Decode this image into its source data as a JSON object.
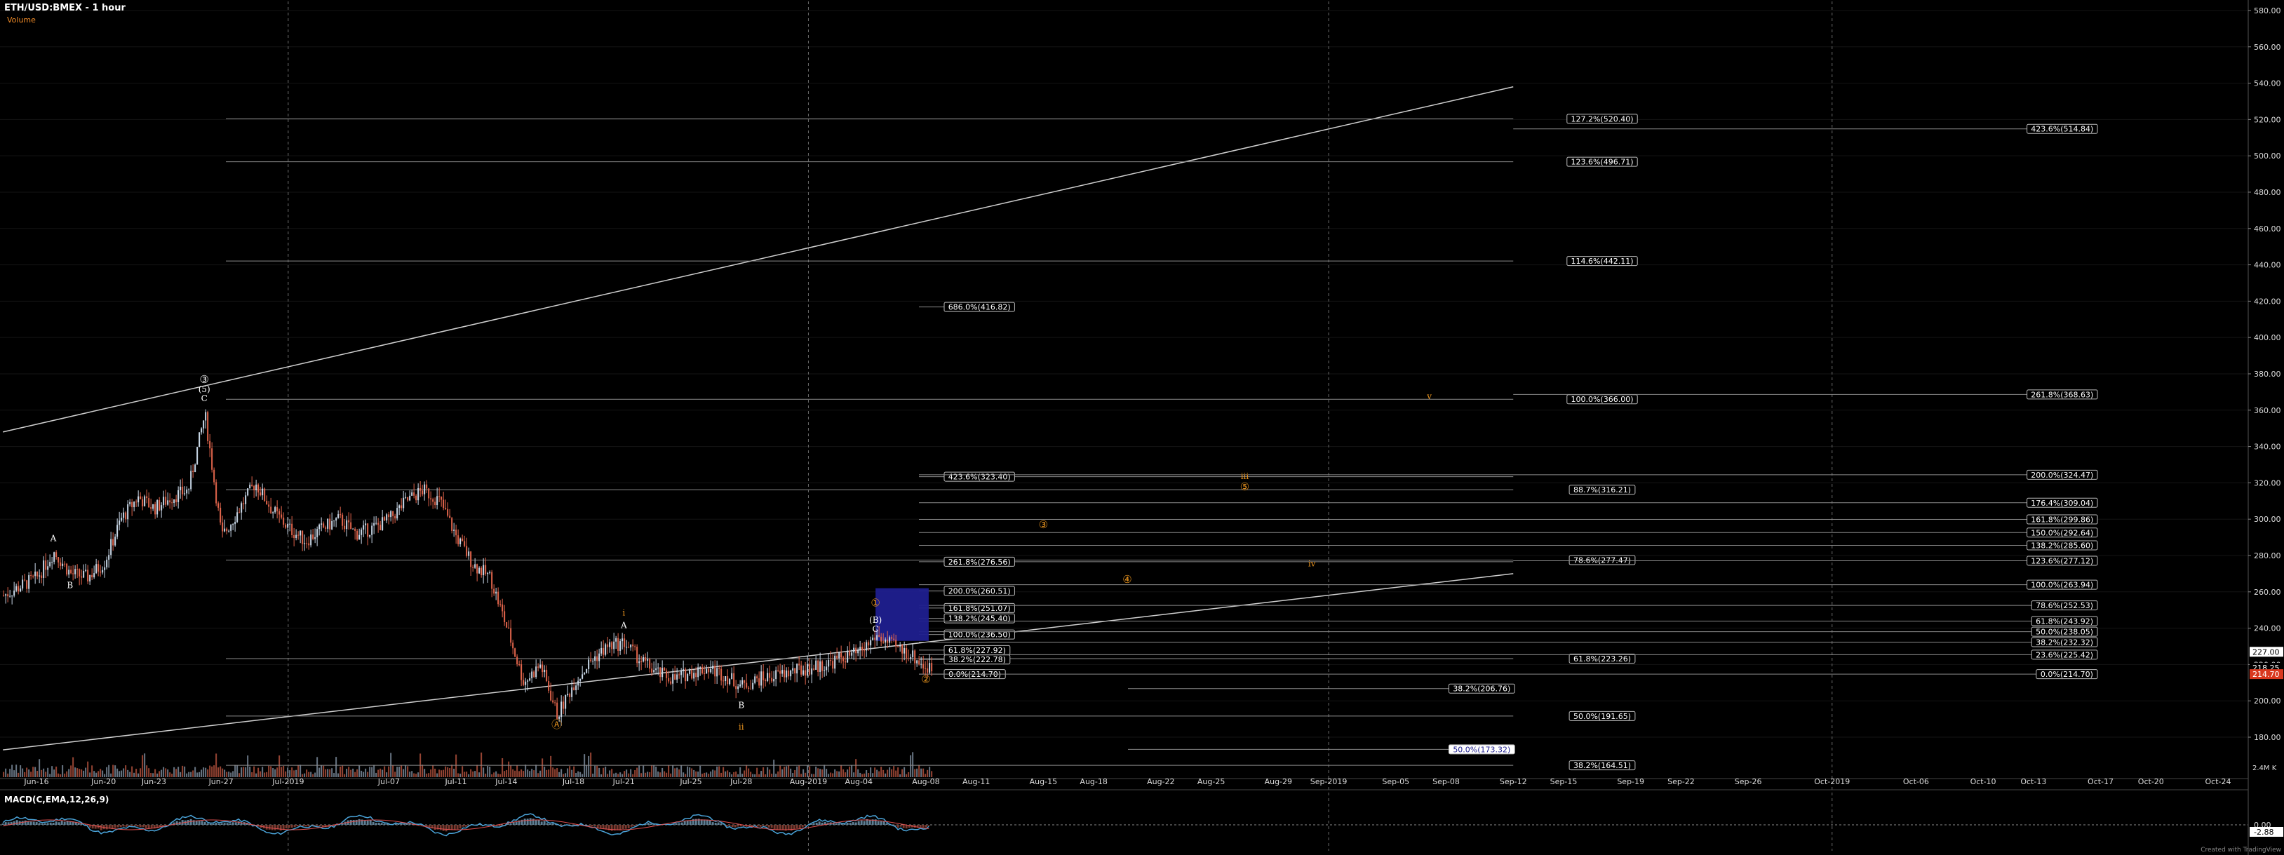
{
  "header": {
    "title": "ETH/USD:BMEX - 1 hour",
    "subtitle": "Volume"
  },
  "macd": {
    "label": "MACD(C,EMA,12,26,9)",
    "value_1": "0.00",
    "value_2": "-2.88"
  },
  "footer": {
    "volume_readout": "2.4M K",
    "watermark": "Created with TradingView"
  },
  "colors": {
    "background": "#000000",
    "grid": "#3a3a3a",
    "fib_line": "#8a8a8a",
    "candle_up": "#c9d8e8",
    "candle_down": "#e2654c",
    "wave_orange": "#e8931e",
    "wave_white": "#ffffff",
    "box_fill": "#1f1f8f",
    "macd": "#4aa3d8",
    "signal": "#e05050"
  },
  "chart_data": {
    "type": "candlestick",
    "title": "ETH/USD:BMEX - 1 hour",
    "ylim": [
      158,
      585
    ],
    "price_axis_ticks": [
      180,
      200,
      220,
      240,
      260,
      280,
      300,
      320,
      340,
      360,
      380,
      400,
      420,
      440,
      460,
      480,
      500,
      520,
      540,
      560,
      580
    ],
    "price_axis_tick_labels": [
      "180.00",
      "200.00",
      "220.00",
      "240.00",
      "260.00",
      "280.00",
      "300.00",
      "320.00",
      "340.00",
      "360.00",
      "380.00",
      "400.00",
      "420.00",
      "440.00",
      "460.00",
      "480.00",
      "500.00",
      "520.00",
      "540.00",
      "560.00",
      "580.00"
    ],
    "price_axis_markers": [
      {
        "value": 227.0,
        "label": "227.00",
        "style": "white"
      },
      {
        "value": 218.25,
        "label": "218.25",
        "style": "plain"
      },
      {
        "value": 214.7,
        "label": "214.70",
        "style": "red"
      }
    ],
    "date_ticks": [
      "Jun-16",
      "Jun-20",
      "Jun-23",
      "Jun-27",
      "Jul-2019",
      "Jul-07",
      "Jul-11",
      "Jul-14",
      "Jul-18",
      "Jul-21",
      "Jul-25",
      "Jul-28",
      "Aug-2019",
      "Aug-04",
      "Aug-08",
      "Aug-11",
      "Aug-15",
      "Aug-18",
      "Aug-22",
      "Aug-25",
      "Aug-29",
      "Sep-2019",
      "Sep-05",
      "Sep-08",
      "Sep-12",
      "Sep-15",
      "Sep-19",
      "Sep-22",
      "Sep-26",
      "Oct-2019",
      "Oct-06",
      "Oct-10",
      "Oct-13",
      "Oct-17",
      "Oct-20",
      "Oct-24"
    ],
    "month_separators": [
      "Jul-2019",
      "Aug-2019",
      "Sep-2019",
      "Oct-2019"
    ],
    "price_path": [
      {
        "date": "Jun-14",
        "price": 258
      },
      {
        "date": "Jun-16",
        "price": 268
      },
      {
        "date": "Jun-17",
        "price": 282
      },
      {
        "date": "Jun-18",
        "price": 270
      },
      {
        "date": "Jun-19",
        "price": 268
      },
      {
        "date": "Jun-20",
        "price": 276
      },
      {
        "date": "Jun-21",
        "price": 300
      },
      {
        "date": "Jun-22",
        "price": 312
      },
      {
        "date": "Jun-23",
        "price": 306
      },
      {
        "date": "Jun-24",
        "price": 312
      },
      {
        "date": "Jun-25",
        "price": 316
      },
      {
        "date": "Jun-26",
        "price": 358
      },
      {
        "date": "Jun-27",
        "price": 290
      },
      {
        "date": "Jun-28",
        "price": 305
      },
      {
        "date": "Jun-29",
        "price": 320
      },
      {
        "date": "Jun-30",
        "price": 305
      },
      {
        "date": "Jul-01",
        "price": 295
      },
      {
        "date": "Jul-02",
        "price": 288
      },
      {
        "date": "Jul-03",
        "price": 295
      },
      {
        "date": "Jul-04",
        "price": 300
      },
      {
        "date": "Jul-05",
        "price": 292
      },
      {
        "date": "Jul-06",
        "price": 295
      },
      {
        "date": "Jul-07",
        "price": 300
      },
      {
        "date": "Jul-08",
        "price": 310
      },
      {
        "date": "Jul-09",
        "price": 316
      },
      {
        "date": "Jul-10",
        "price": 310
      },
      {
        "date": "Jul-11",
        "price": 290
      },
      {
        "date": "Jul-12",
        "price": 275
      },
      {
        "date": "Jul-13",
        "price": 268
      },
      {
        "date": "Jul-14",
        "price": 240
      },
      {
        "date": "Jul-15",
        "price": 210
      },
      {
        "date": "Jul-16",
        "price": 220
      },
      {
        "date": "Jul-17",
        "price": 192
      },
      {
        "date": "Jul-18",
        "price": 210
      },
      {
        "date": "Jul-19",
        "price": 222
      },
      {
        "date": "Jul-20",
        "price": 230
      },
      {
        "date": "Jul-21",
        "price": 232
      },
      {
        "date": "Jul-22",
        "price": 222
      },
      {
        "date": "Jul-23",
        "price": 215
      },
      {
        "date": "Jul-24",
        "price": 212
      },
      {
        "date": "Jul-25",
        "price": 216
      },
      {
        "date": "Jul-26",
        "price": 218
      },
      {
        "date": "Jul-27",
        "price": 214
      },
      {
        "date": "Jul-28",
        "price": 208
      },
      {
        "date": "Jul-29",
        "price": 212
      },
      {
        "date": "Jul-30",
        "price": 214
      },
      {
        "date": "Jul-31",
        "price": 216
      },
      {
        "date": "Aug-01",
        "price": 218
      },
      {
        "date": "Aug-02",
        "price": 220
      },
      {
        "date": "Aug-03",
        "price": 224
      },
      {
        "date": "Aug-04",
        "price": 226
      },
      {
        "date": "Aug-05",
        "price": 236
      },
      {
        "date": "Aug-06",
        "price": 230
      },
      {
        "date": "Aug-07",
        "price": 226
      },
      {
        "date": "Aug-08",
        "price": 218
      }
    ],
    "fib_levels": [
      {
        "label": "127.2%(520.40)",
        "value": 520.4,
        "from": "Jun-26",
        "to": "Sep-12",
        "box": "center"
      },
      {
        "label": "123.6%(496.71)",
        "value": 496.71,
        "from": "Jun-26",
        "to": "Sep-12",
        "box": "center"
      },
      {
        "label": "114.6%(442.11)",
        "value": 442.11,
        "from": "Jun-26",
        "to": "Sep-12",
        "box": "center"
      },
      {
        "label": "100.0%(366.00)",
        "value": 366.0,
        "from": "Jun-26",
        "to": "Sep-12",
        "box": "center"
      },
      {
        "label": "88.7%(316.21)",
        "value": 316.21,
        "from": "Jun-26",
        "to": "Sep-12",
        "box": "center"
      },
      {
        "label": "78.6%(277.47)",
        "value": 277.47,
        "from": "Jun-26",
        "to": "Sep-12",
        "box": "center"
      },
      {
        "label": "61.8%(223.26)",
        "value": 223.26,
        "from": "Jun-26",
        "to": "Sep-12",
        "box": "center"
      },
      {
        "label": "50.0%(191.65)",
        "value": 191.65,
        "from": "Jun-26",
        "to": "Sep-12",
        "box": "center"
      },
      {
        "label": "38.2%(164.51)",
        "value": 164.51,
        "from": "Jun-26",
        "to": "Sep-12",
        "box": "center"
      },
      {
        "label": "686.0%(416.82)",
        "value": 416.82,
        "from": "Aug-08",
        "to": "Aug-08",
        "box": "left"
      },
      {
        "label": "423.6%(323.40)",
        "value": 323.4,
        "from": "Aug-08",
        "to": "Sep-12",
        "box": "left"
      },
      {
        "label": "261.8%(276.56)",
        "value": 276.56,
        "from": "Aug-08",
        "to": "Sep-12",
        "box": "left"
      },
      {
        "label": "200.0%(260.51)",
        "value": 260.51,
        "from": "Aug-08",
        "to": "Aug-08",
        "box": "left"
      },
      {
        "label": "161.8%(251.07)",
        "value": 251.07,
        "from": "Aug-08",
        "to": "Aug-08",
        "box": "left"
      },
      {
        "label": "138.2%(245.40)",
        "value": 245.4,
        "from": "Aug-08",
        "to": "Aug-08",
        "box": "left"
      },
      {
        "label": "100.0%(236.50)",
        "value": 236.5,
        "from": "Aug-08",
        "to": "Aug-08",
        "box": "left"
      },
      {
        "label": "61.8%(227.92)",
        "value": 227.92,
        "from": "Aug-08",
        "to": "Aug-08",
        "box": "left"
      },
      {
        "label": "38.2%(222.78)",
        "value": 222.78,
        "from": "Aug-08",
        "to": "Aug-08",
        "box": "left"
      },
      {
        "label": "0.0%(214.70)",
        "value": 214.7,
        "from": "Aug-08",
        "to": "Aug-08",
        "box": "left"
      },
      {
        "label": "38.2%(206.76)",
        "value": 206.76,
        "from": "Aug-18",
        "to": "Sep-12",
        "box": "right"
      },
      {
        "label": "50.0%(173.32)",
        "value": 173.32,
        "from": "Aug-18",
        "to": "Sep-12",
        "box": "right",
        "highlight": true
      },
      {
        "label": "423.6%(514.84)",
        "value": 514.84,
        "from": "Sep-12",
        "to": "Oct-20",
        "box": "right"
      },
      {
        "label": "261.8%(368.63)",
        "value": 368.63,
        "from": "Sep-12",
        "to": "Oct-20",
        "box": "right"
      },
      {
        "label": "200.0%(324.47)",
        "value": 324.47,
        "from": "Aug-08",
        "to": "Oct-20",
        "box": "right"
      },
      {
        "label": "176.4%(309.04)",
        "value": 309.04,
        "from": "Aug-08",
        "to": "Oct-20",
        "box": "right"
      },
      {
        "label": "161.8%(299.86)",
        "value": 299.86,
        "from": "Aug-08",
        "to": "Oct-20",
        "box": "right"
      },
      {
        "label": "150.0%(292.64)",
        "value": 292.64,
        "from": "Aug-08",
        "to": "Oct-20",
        "box": "right"
      },
      {
        "label": "138.2%(285.60)",
        "value": 285.6,
        "from": "Aug-08",
        "to": "Oct-20",
        "box": "right"
      },
      {
        "label": "123.6%(277.12)",
        "value": 277.12,
        "from": "Sep-12",
        "to": "Oct-20",
        "box": "right"
      },
      {
        "label": "100.0%(263.94)",
        "value": 263.94,
        "from": "Aug-08",
        "to": "Oct-20",
        "box": "right"
      },
      {
        "label": "78.6%(252.53)",
        "value": 252.53,
        "from": "Aug-08",
        "to": "Oct-20",
        "box": "right"
      },
      {
        "label": "61.8%(243.92)",
        "value": 243.92,
        "from": "Aug-08",
        "to": "Oct-20",
        "box": "right"
      },
      {
        "label": "50.0%(238.05)",
        "value": 238.05,
        "from": "Aug-08",
        "to": "Oct-20",
        "box": "right"
      },
      {
        "label": "38.2%(232.32)",
        "value": 232.32,
        "from": "Aug-08",
        "to": "Oct-20",
        "box": "right"
      },
      {
        "label": "23.6%(225.42)",
        "value": 225.42,
        "from": "Aug-08",
        "to": "Oct-20",
        "box": "right"
      },
      {
        "label": "0.0%(214.70)",
        "value": 214.7,
        "from": "Aug-08",
        "to": "Oct-20",
        "box": "right"
      }
    ],
    "trend_lines": [
      {
        "from": {
          "date": "Jun-14",
          "price": 348
        },
        "to": {
          "date": "Sep-12",
          "price": 538
        }
      },
      {
        "from": {
          "date": "Jun-14",
          "price": 173
        },
        "to": {
          "date": "Sep-12",
          "price": 270
        }
      }
    ],
    "target_box": {
      "from": "Aug-05",
      "to": "Aug-08",
      "top": 262,
      "bottom": 233
    },
    "wave_labels": [
      {
        "text": "③",
        "date": "Jun-26",
        "price": 375,
        "color": "white"
      },
      {
        "text": "(5)",
        "date": "Jun-26",
        "price": 370,
        "color": "white"
      },
      {
        "text": "C",
        "date": "Jun-26",
        "price": 365,
        "color": "white"
      },
      {
        "text": "A",
        "date": "Jun-17",
        "price": 288,
        "color": "white"
      },
      {
        "text": "B",
        "date": "Jun-18",
        "price": 262,
        "color": "white"
      },
      {
        "text": "i",
        "date": "Jul-21",
        "price": 247,
        "color": "orange"
      },
      {
        "text": "A",
        "date": "Jul-21",
        "price": 240,
        "color": "white"
      },
      {
        "text": "Ⓐ",
        "date": "Jul-17",
        "price": 185,
        "color": "orange"
      },
      {
        "text": "B",
        "date": "Jul-28",
        "price": 196,
        "color": "white"
      },
      {
        "text": "ii",
        "date": "Jul-28",
        "price": 184,
        "color": "orange"
      },
      {
        "text": "①",
        "date": "Aug-05",
        "price": 252,
        "color": "orange"
      },
      {
        "text": "(B)",
        "date": "Aug-05",
        "price": 243,
        "color": "white"
      },
      {
        "text": "C",
        "date": "Aug-05",
        "price": 238,
        "color": "white"
      },
      {
        "text": "②",
        "date": "Aug-08",
        "price": 210,
        "color": "orange"
      },
      {
        "text": "③",
        "date": "Aug-15",
        "price": 295,
        "color": "orange"
      },
      {
        "text": "④",
        "date": "Aug-20",
        "price": 265,
        "color": "orange"
      },
      {
        "text": "iii",
        "date": "Aug-27",
        "price": 322,
        "color": "orange"
      },
      {
        "text": "⑤",
        "date": "Aug-27",
        "price": 316,
        "color": "orange"
      },
      {
        "text": "iv",
        "date": "Aug-31",
        "price": 274,
        "color": "orange"
      },
      {
        "text": "v",
        "date": "Sep-07",
        "price": 366,
        "color": "orange"
      }
    ]
  }
}
